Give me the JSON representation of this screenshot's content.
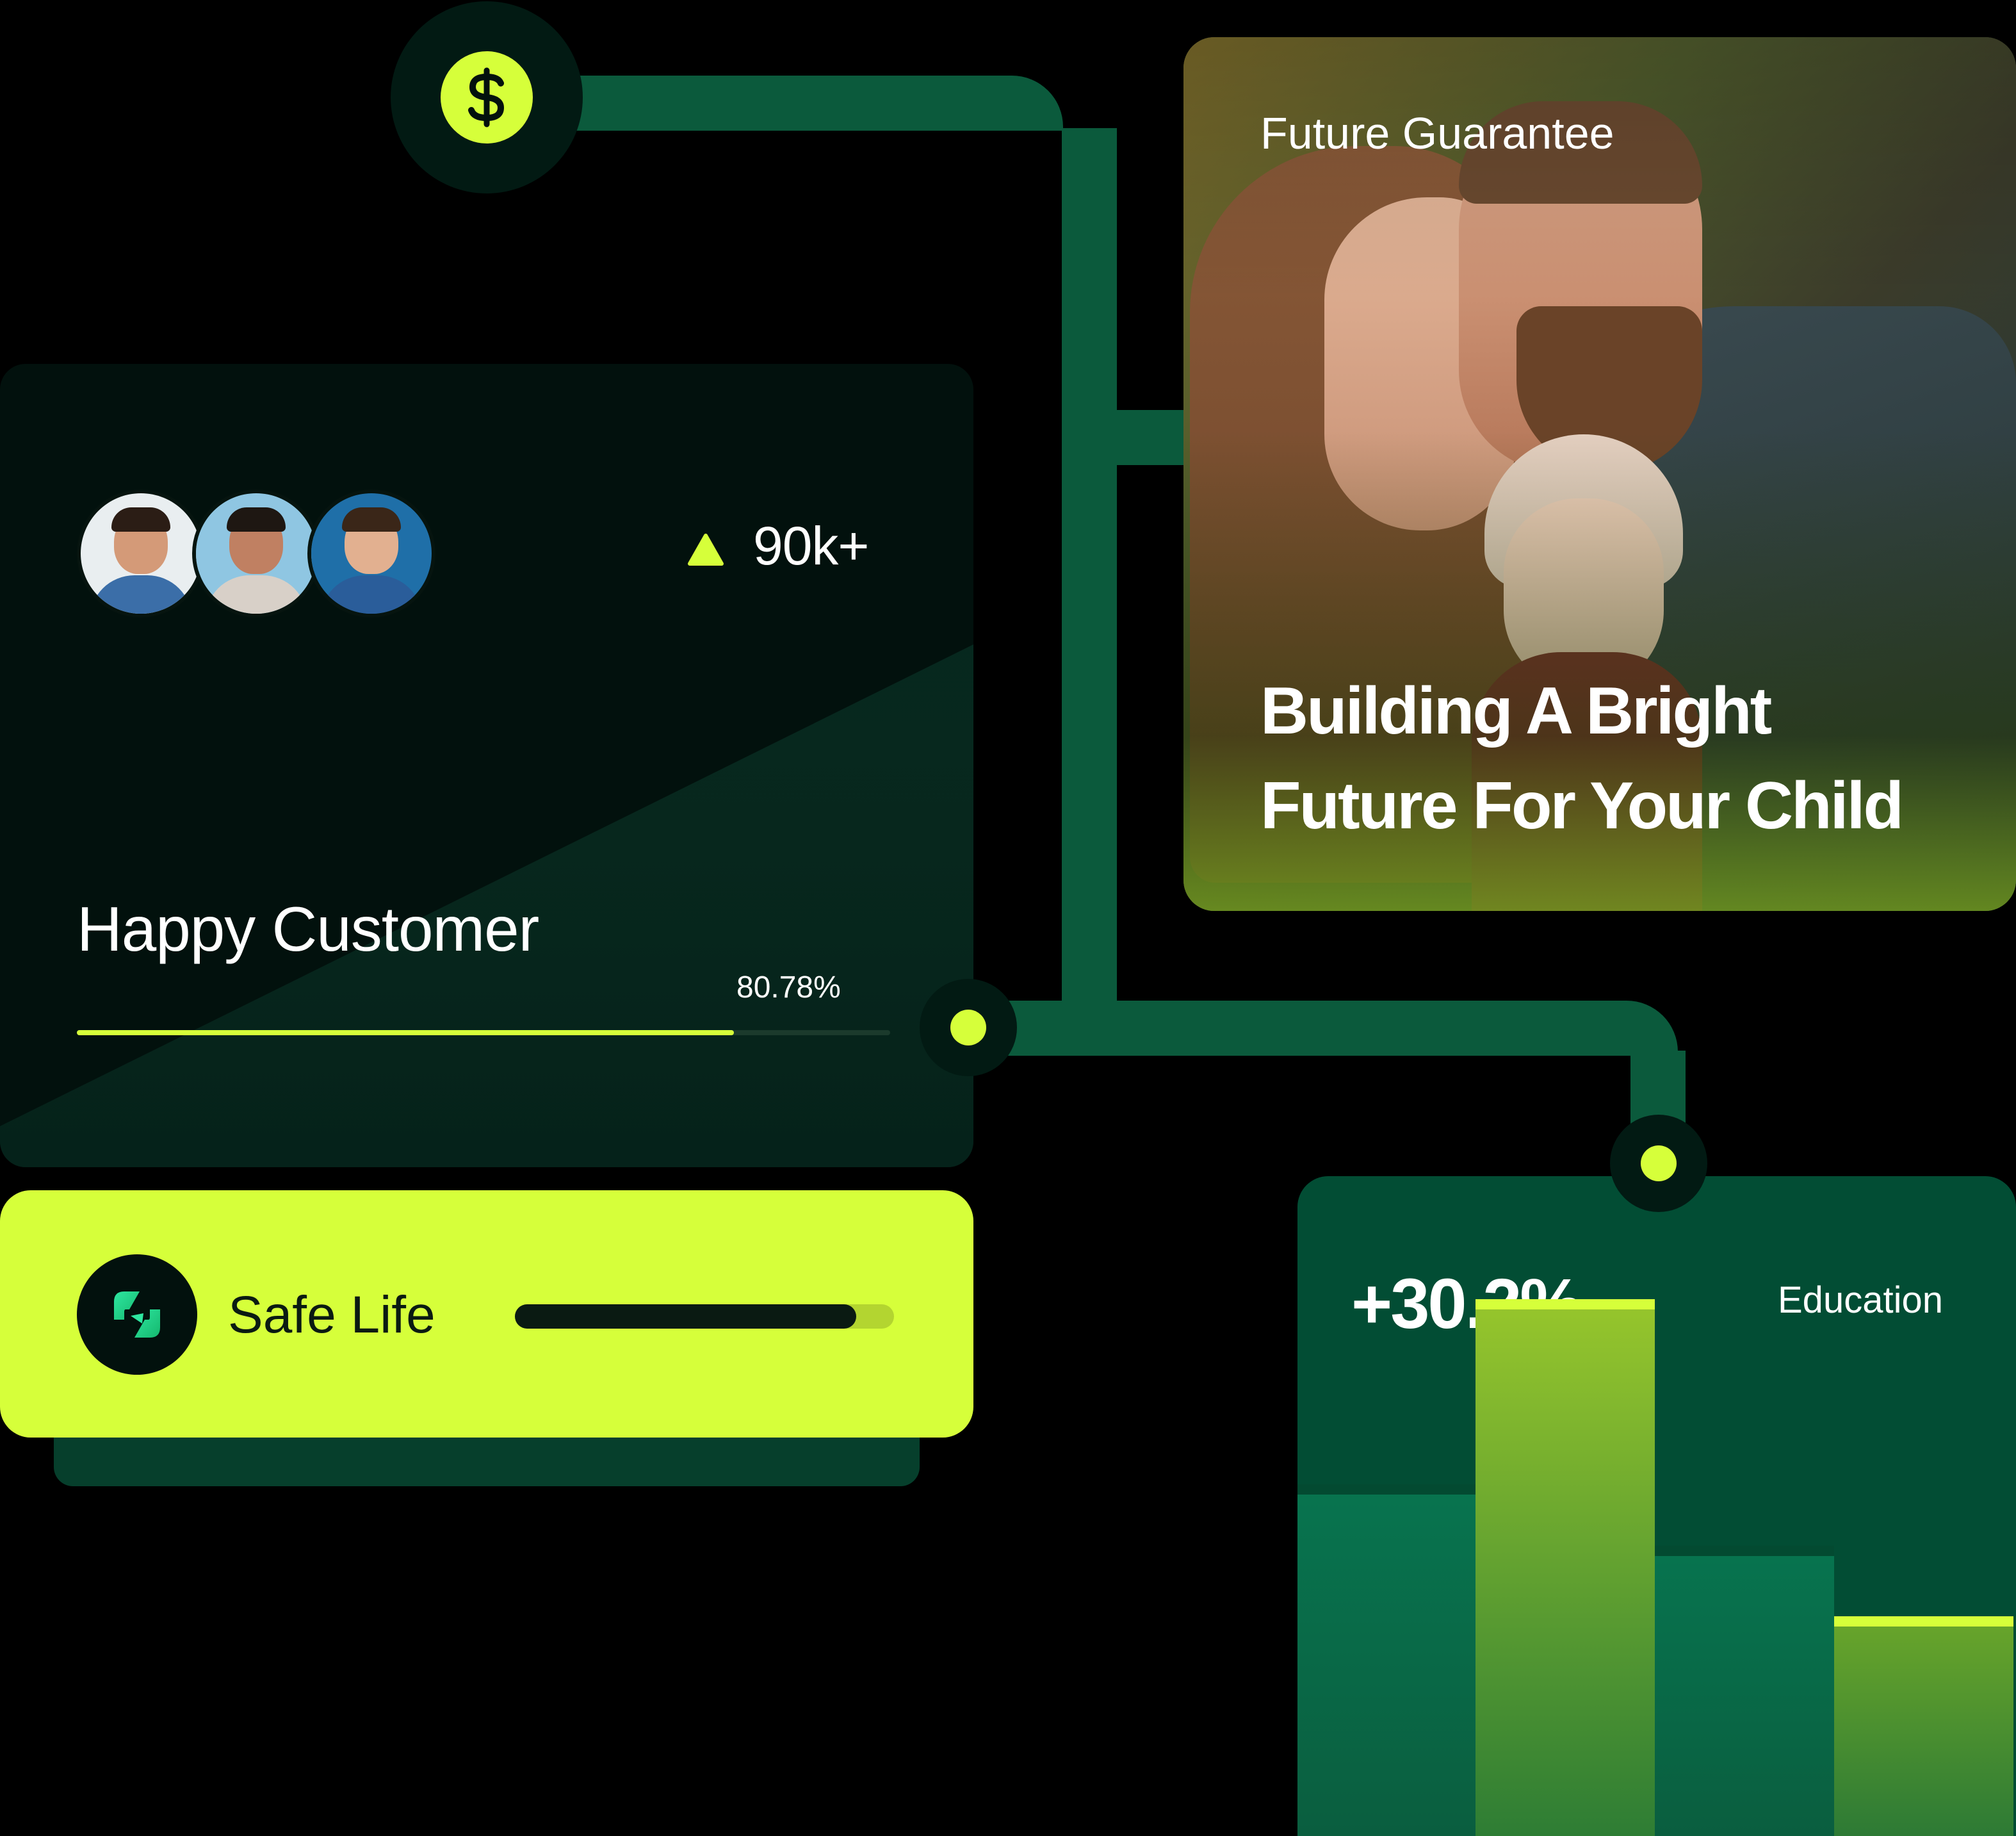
{
  "customer_card": {
    "stat_value": "90k+",
    "title": "Happy Customer",
    "progress_label": "80.78%",
    "progress": 0.8078
  },
  "safe_card": {
    "title": "Safe Life",
    "progress": 0.9
  },
  "photo_card": {
    "subtitle": "Future Guarantee",
    "headline_line1": "Building A Bright",
    "headline_line2": "Future For Your Child"
  },
  "edu_card": {
    "value": "+30.2%",
    "label": "Education"
  },
  "icons": {
    "dollar": "dollar-icon",
    "up_triangle": "triangle-up-icon",
    "safe_logo": "safe-life-logo-icon"
  },
  "colors": {
    "accent": "#d6ff3a",
    "connector": "#0b5a3c",
    "card_dark": "#02110d",
    "card_green": "#024d34"
  },
  "chart_data": {
    "type": "bar",
    "categories": [
      "",
      "",
      "",
      ""
    ],
    "values": [
      40,
      61,
      33,
      25
    ],
    "ylim": [
      0,
      75
    ],
    "grid": false,
    "legend": "none"
  }
}
